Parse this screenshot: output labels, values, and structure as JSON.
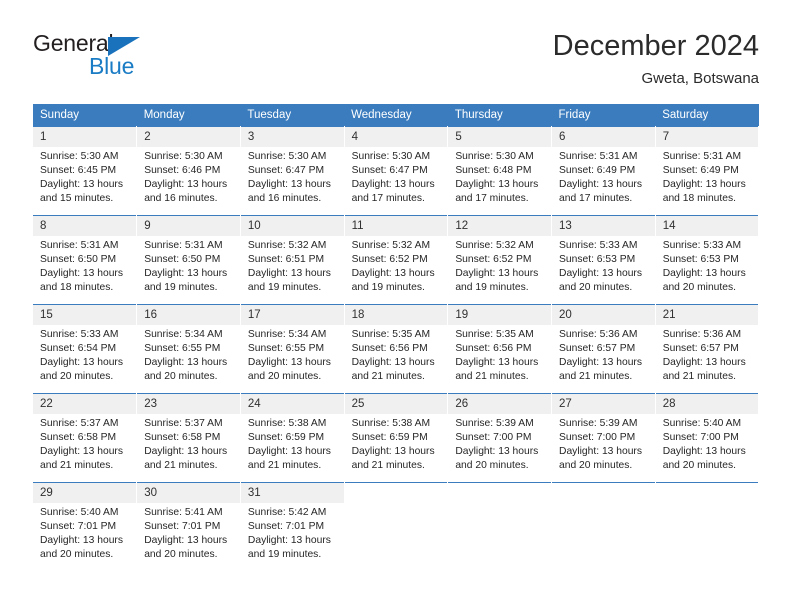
{
  "brand": {
    "name_part1": "General",
    "name_part2": "Blue",
    "triangle_color": "#1a72bd",
    "text_color": "#231f20",
    "accent_color": "#1a7cc4"
  },
  "header": {
    "title": "December 2024",
    "subtitle": "Gweta, Botswana"
  },
  "theme": {
    "header_bar_color": "#3a7cbe",
    "daynum_band_color": "#f0f0f0",
    "cell_text_color": "#262626"
  },
  "weekdays": [
    "Sunday",
    "Monday",
    "Tuesday",
    "Wednesday",
    "Thursday",
    "Friday",
    "Saturday"
  ],
  "weeks": [
    [
      {
        "day": "1",
        "sunrise": "Sunrise: 5:30 AM",
        "sunset": "Sunset: 6:45 PM",
        "daylight1": "Daylight: 13 hours",
        "daylight2": "and 15 minutes."
      },
      {
        "day": "2",
        "sunrise": "Sunrise: 5:30 AM",
        "sunset": "Sunset: 6:46 PM",
        "daylight1": "Daylight: 13 hours",
        "daylight2": "and 16 minutes."
      },
      {
        "day": "3",
        "sunrise": "Sunrise: 5:30 AM",
        "sunset": "Sunset: 6:47 PM",
        "daylight1": "Daylight: 13 hours",
        "daylight2": "and 16 minutes."
      },
      {
        "day": "4",
        "sunrise": "Sunrise: 5:30 AM",
        "sunset": "Sunset: 6:47 PM",
        "daylight1": "Daylight: 13 hours",
        "daylight2": "and 17 minutes."
      },
      {
        "day": "5",
        "sunrise": "Sunrise: 5:30 AM",
        "sunset": "Sunset: 6:48 PM",
        "daylight1": "Daylight: 13 hours",
        "daylight2": "and 17 minutes."
      },
      {
        "day": "6",
        "sunrise": "Sunrise: 5:31 AM",
        "sunset": "Sunset: 6:49 PM",
        "daylight1": "Daylight: 13 hours",
        "daylight2": "and 17 minutes."
      },
      {
        "day": "7",
        "sunrise": "Sunrise: 5:31 AM",
        "sunset": "Sunset: 6:49 PM",
        "daylight1": "Daylight: 13 hours",
        "daylight2": "and 18 minutes."
      }
    ],
    [
      {
        "day": "8",
        "sunrise": "Sunrise: 5:31 AM",
        "sunset": "Sunset: 6:50 PM",
        "daylight1": "Daylight: 13 hours",
        "daylight2": "and 18 minutes."
      },
      {
        "day": "9",
        "sunrise": "Sunrise: 5:31 AM",
        "sunset": "Sunset: 6:50 PM",
        "daylight1": "Daylight: 13 hours",
        "daylight2": "and 19 minutes."
      },
      {
        "day": "10",
        "sunrise": "Sunrise: 5:32 AM",
        "sunset": "Sunset: 6:51 PM",
        "daylight1": "Daylight: 13 hours",
        "daylight2": "and 19 minutes."
      },
      {
        "day": "11",
        "sunrise": "Sunrise: 5:32 AM",
        "sunset": "Sunset: 6:52 PM",
        "daylight1": "Daylight: 13 hours",
        "daylight2": "and 19 minutes."
      },
      {
        "day": "12",
        "sunrise": "Sunrise: 5:32 AM",
        "sunset": "Sunset: 6:52 PM",
        "daylight1": "Daylight: 13 hours",
        "daylight2": "and 19 minutes."
      },
      {
        "day": "13",
        "sunrise": "Sunrise: 5:33 AM",
        "sunset": "Sunset: 6:53 PM",
        "daylight1": "Daylight: 13 hours",
        "daylight2": "and 20 minutes."
      },
      {
        "day": "14",
        "sunrise": "Sunrise: 5:33 AM",
        "sunset": "Sunset: 6:53 PM",
        "daylight1": "Daylight: 13 hours",
        "daylight2": "and 20 minutes."
      }
    ],
    [
      {
        "day": "15",
        "sunrise": "Sunrise: 5:33 AM",
        "sunset": "Sunset: 6:54 PM",
        "daylight1": "Daylight: 13 hours",
        "daylight2": "and 20 minutes."
      },
      {
        "day": "16",
        "sunrise": "Sunrise: 5:34 AM",
        "sunset": "Sunset: 6:55 PM",
        "daylight1": "Daylight: 13 hours",
        "daylight2": "and 20 minutes."
      },
      {
        "day": "17",
        "sunrise": "Sunrise: 5:34 AM",
        "sunset": "Sunset: 6:55 PM",
        "daylight1": "Daylight: 13 hours",
        "daylight2": "and 20 minutes."
      },
      {
        "day": "18",
        "sunrise": "Sunrise: 5:35 AM",
        "sunset": "Sunset: 6:56 PM",
        "daylight1": "Daylight: 13 hours",
        "daylight2": "and 21 minutes."
      },
      {
        "day": "19",
        "sunrise": "Sunrise: 5:35 AM",
        "sunset": "Sunset: 6:56 PM",
        "daylight1": "Daylight: 13 hours",
        "daylight2": "and 21 minutes."
      },
      {
        "day": "20",
        "sunrise": "Sunrise: 5:36 AM",
        "sunset": "Sunset: 6:57 PM",
        "daylight1": "Daylight: 13 hours",
        "daylight2": "and 21 minutes."
      },
      {
        "day": "21",
        "sunrise": "Sunrise: 5:36 AM",
        "sunset": "Sunset: 6:57 PM",
        "daylight1": "Daylight: 13 hours",
        "daylight2": "and 21 minutes."
      }
    ],
    [
      {
        "day": "22",
        "sunrise": "Sunrise: 5:37 AM",
        "sunset": "Sunset: 6:58 PM",
        "daylight1": "Daylight: 13 hours",
        "daylight2": "and 21 minutes."
      },
      {
        "day": "23",
        "sunrise": "Sunrise: 5:37 AM",
        "sunset": "Sunset: 6:58 PM",
        "daylight1": "Daylight: 13 hours",
        "daylight2": "and 21 minutes."
      },
      {
        "day": "24",
        "sunrise": "Sunrise: 5:38 AM",
        "sunset": "Sunset: 6:59 PM",
        "daylight1": "Daylight: 13 hours",
        "daylight2": "and 21 minutes."
      },
      {
        "day": "25",
        "sunrise": "Sunrise: 5:38 AM",
        "sunset": "Sunset: 6:59 PM",
        "daylight1": "Daylight: 13 hours",
        "daylight2": "and 21 minutes."
      },
      {
        "day": "26",
        "sunrise": "Sunrise: 5:39 AM",
        "sunset": "Sunset: 7:00 PM",
        "daylight1": "Daylight: 13 hours",
        "daylight2": "and 20 minutes."
      },
      {
        "day": "27",
        "sunrise": "Sunrise: 5:39 AM",
        "sunset": "Sunset: 7:00 PM",
        "daylight1": "Daylight: 13 hours",
        "daylight2": "and 20 minutes."
      },
      {
        "day": "28",
        "sunrise": "Sunrise: 5:40 AM",
        "sunset": "Sunset: 7:00 PM",
        "daylight1": "Daylight: 13 hours",
        "daylight2": "and 20 minutes."
      }
    ],
    [
      {
        "day": "29",
        "sunrise": "Sunrise: 5:40 AM",
        "sunset": "Sunset: 7:01 PM",
        "daylight1": "Daylight: 13 hours",
        "daylight2": "and 20 minutes."
      },
      {
        "day": "30",
        "sunrise": "Sunrise: 5:41 AM",
        "sunset": "Sunset: 7:01 PM",
        "daylight1": "Daylight: 13 hours",
        "daylight2": "and 20 minutes."
      },
      {
        "day": "31",
        "sunrise": "Sunrise: 5:42 AM",
        "sunset": "Sunset: 7:01 PM",
        "daylight1": "Daylight: 13 hours",
        "daylight2": "and 19 minutes."
      },
      {
        "day": "",
        "sunrise": "",
        "sunset": "",
        "daylight1": "",
        "daylight2": ""
      },
      {
        "day": "",
        "sunrise": "",
        "sunset": "",
        "daylight1": "",
        "daylight2": ""
      },
      {
        "day": "",
        "sunrise": "",
        "sunset": "",
        "daylight1": "",
        "daylight2": ""
      },
      {
        "day": "",
        "sunrise": "",
        "sunset": "",
        "daylight1": "",
        "daylight2": ""
      }
    ]
  ]
}
